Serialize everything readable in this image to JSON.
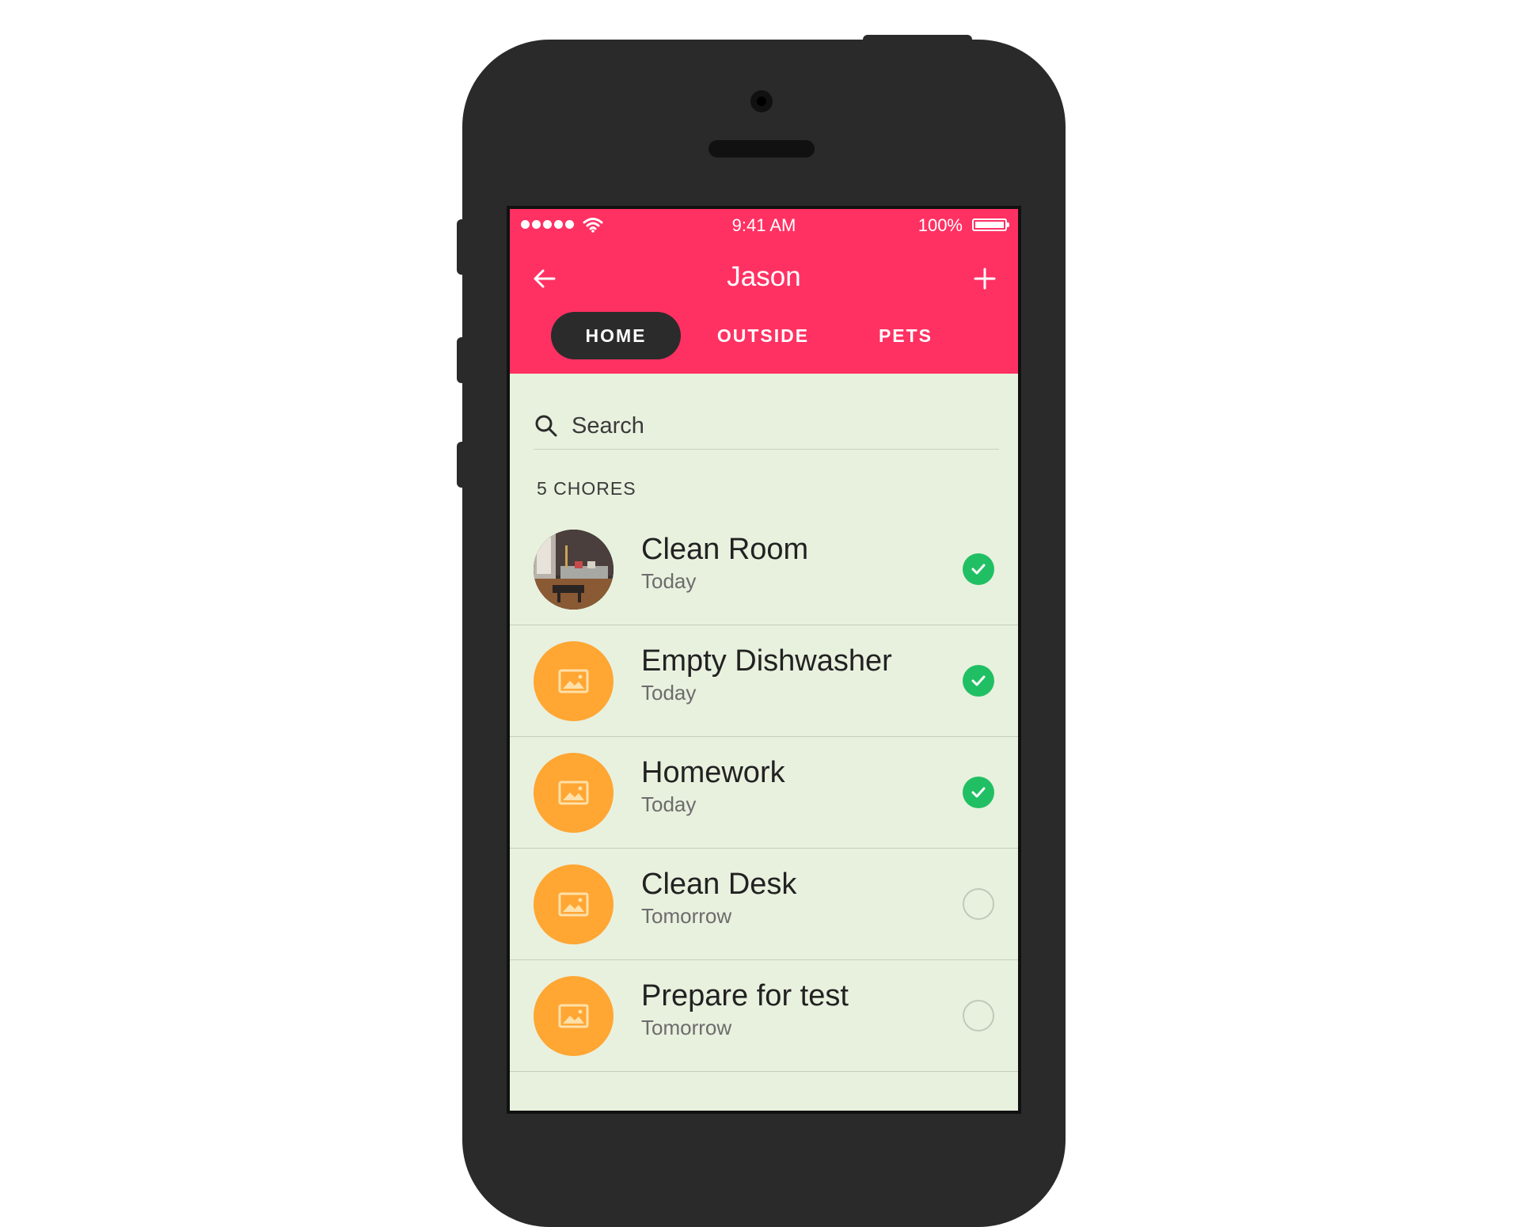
{
  "colors": {
    "header": "#ff3163",
    "active_tab": "#2b2b2b",
    "background": "#e8f1de",
    "placeholder_avatar": "#ffa633",
    "check_done": "#21bf63"
  },
  "status_bar": {
    "time": "9:41 AM",
    "battery": "100%"
  },
  "header": {
    "title": "Jason",
    "back_icon": "arrow-left-icon",
    "add_icon": "plus-icon"
  },
  "tabs": [
    {
      "label": "HOME",
      "active": true
    },
    {
      "label": "OUTSIDE",
      "active": false
    },
    {
      "label": "PETS",
      "active": false
    }
  ],
  "search": {
    "placeholder": "Search"
  },
  "list": {
    "count_label": "5 CHORES",
    "chores": [
      {
        "title": "Clean Room",
        "due": "Today",
        "done": true,
        "avatar": "photo"
      },
      {
        "title": "Empty Dishwasher",
        "due": "Today",
        "done": true,
        "avatar": "image-placeholder-icon"
      },
      {
        "title": "Homework",
        "due": "Today",
        "done": true,
        "avatar": "image-placeholder-icon"
      },
      {
        "title": "Clean Desk",
        "due": "Tomorrow",
        "done": false,
        "avatar": "image-placeholder-icon"
      },
      {
        "title": "Prepare for test",
        "due": "Tomorrow",
        "done": false,
        "avatar": "image-placeholder-icon"
      }
    ]
  }
}
